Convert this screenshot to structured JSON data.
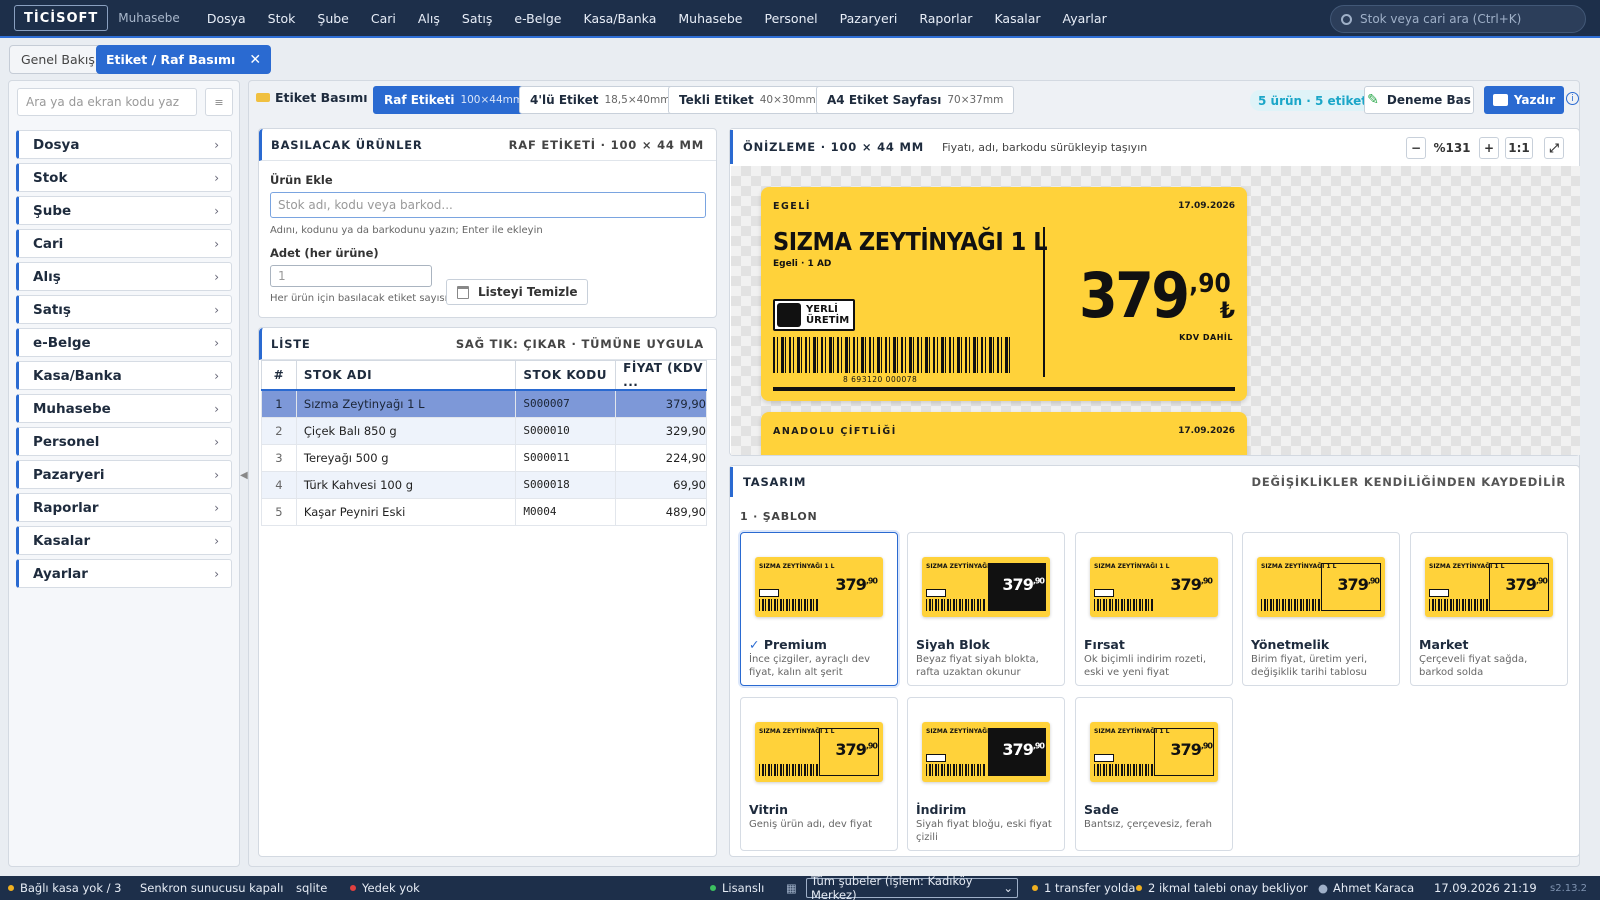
{
  "app": {
    "logo": "TİCİSOFT",
    "module": "Muhasebe"
  },
  "topmenu": [
    "Dosya",
    "Stok",
    "Şube",
    "Cari",
    "Alış",
    "Satış",
    "e-Belge",
    "Kasa/Banka",
    "Muhasebe",
    "Personel",
    "Pazaryeri",
    "Raporlar",
    "Kasalar",
    "Ayarlar"
  ],
  "global_search": {
    "placeholder": "Stok veya cari ara (Ctrl+K)"
  },
  "tabs": [
    {
      "label": "Genel Bakış"
    },
    {
      "label": "Etiket / Raf Basımı",
      "close": "✕"
    }
  ],
  "sidebar": {
    "search_placeholder": "Ara ya da ekran kodu yaz",
    "menu_glyph": "≡",
    "items": [
      "Dosya",
      "Stok",
      "Şube",
      "Cari",
      "Alış",
      "Satış",
      "e-Belge",
      "Kasa/Banka",
      "Muhasebe",
      "Personel",
      "Pazaryeri",
      "Raporlar",
      "Kasalar",
      "Ayarlar"
    ],
    "chevron": "›",
    "collapse_glyph": "◀"
  },
  "toolbar": {
    "title": "Etiket Basımı",
    "label_types": [
      {
        "name": "Raf Etiketi",
        "dim": "100×44mm",
        "active": true
      },
      {
        "name": "4'lü Etiket",
        "dim": "18,5×40mm"
      },
      {
        "name": "Tekli Etiket",
        "dim": "40×30mm"
      },
      {
        "name": "A4 Etiket Sayfası",
        "dim": "70×37mm"
      }
    ],
    "count_badge": "5 ürün · 5 etiket",
    "test_button": "Deneme Bas",
    "print_button": "Yazdır",
    "info_glyph": "i"
  },
  "products_card": {
    "title": "BASILACAK ÜRÜNLER",
    "subtitle": "RAF ETİKETİ · 100 × 44 MM",
    "add_label": "Ürün Ekle",
    "add_placeholder": "Stok adı, kodu veya barkod...",
    "add_hint": "Adını, kodunu ya da barkodunu yazın; Enter ile ekleyin",
    "qty_label": "Adet (her ürüne)",
    "qty_value": "1",
    "qty_hint": "Her ürün için basılacak etiket sayısı",
    "clear_button": "Listeyi Temizle"
  },
  "list_card": {
    "title": "LİSTE",
    "subtitle": "SAĞ TIK: ÇIKAR · TÜMÜNE UYGULA",
    "columns": [
      "#",
      "STOK ADI",
      "STOK KODU",
      "FİYAT (KDV ..."
    ],
    "rows": [
      {
        "n": "1",
        "name": "Sızma Zeytinyağı 1 L",
        "code": "S000007",
        "price": "379,90"
      },
      {
        "n": "2",
        "name": "Çiçek Balı 850 g",
        "code": "S000010",
        "price": "329,90"
      },
      {
        "n": "3",
        "name": "Tereyağı 500 g",
        "code": "S000011",
        "price": "224,90"
      },
      {
        "n": "4",
        "name": "Türk Kahvesi 100 g",
        "code": "S000018",
        "price": "69,90"
      },
      {
        "n": "5",
        "name": "Kaşar Peyniri Eski",
        "code": "M0004",
        "price": "489,90"
      }
    ]
  },
  "preview": {
    "title": "ÖNİZLEME · 100 × 44 MM",
    "hint": "Fiyatı, adı, barkodu sürükleyip taşıyın",
    "zoom_minus": "−",
    "zoom": "%131",
    "zoom_plus": "+",
    "one_to_one": "1:1",
    "fit": "⤢",
    "label1": {
      "brand": "EGELİ",
      "date": "17.09.2026",
      "name": "SIZMA ZEYTİNYAĞI 1 L",
      "sub": "Egeli · 1 AD",
      "price_int": "379",
      "price_dec": ",90",
      "currency": "₺",
      "kdv": "KDV DAHİL",
      "badge_l1": "YERLİ",
      "badge_l2": "ÜRETİM",
      "barcode": "8 693120 000078"
    },
    "label2": {
      "brand": "ANADOLU ÇİFTLİĞİ",
      "date": "17.09.2026"
    }
  },
  "design": {
    "title": "TASARIM",
    "note": "DEĞİŞİKLİKLER KENDİLİĞİNDEN KAYDEDİLİR",
    "section": "1 · ŞABLON",
    "check": "✓",
    "mini": {
      "name": "SIZMA ZEYTİNYAĞI 1 L",
      "price": "379",
      "dec": ",90"
    },
    "templates": [
      {
        "name": "Premium",
        "desc": "İnce çizgiler, ayraçlı dev fiyat, kalın alt şerit",
        "selected": true
      },
      {
        "name": "Siyah Blok",
        "desc": "Beyaz fiyat siyah blokta, rafta uzaktan okunur"
      },
      {
        "name": "Fırsat",
        "desc": "Ok biçimli indirim rozeti, eski ve yeni fiyat"
      },
      {
        "name": "Yönetmelik",
        "desc": "Birim fiyat, üretim yeri, değişiklik tarihi tablosu"
      },
      {
        "name": "Market",
        "desc": "Çerçeveli fiyat sağda, barkod solda"
      },
      {
        "name": "Vitrin",
        "desc": "Geniş ürün adı, dev fiyat"
      },
      {
        "name": "İndirim",
        "desc": "Siyah fiyat bloğu, eski fiyat çizili"
      },
      {
        "name": "Sade",
        "desc": "Bantsız, çerçevesiz, ferah"
      }
    ]
  },
  "status": {
    "kasa": "Bağlı kasa yok / 3",
    "sync": "Senkron sunucusu kapalı",
    "db": "sqlite",
    "backup": "Yedek yok",
    "license": "Lisanslı",
    "branch": "Tüm şubeler (işlem: Kadıköy Merkez)",
    "transfer": "1 transfer yolda",
    "ikmal": "2 ikmal talebi onay bekliyor",
    "user": "Ahmet Karaca",
    "datetime": "17.09.2026 21:19",
    "version": "s2.13.2"
  },
  "colors": {
    "accent": "#2a6ad1",
    "label_yellow": "#ffd23a",
    "topbar": "#1d2f4a"
  }
}
